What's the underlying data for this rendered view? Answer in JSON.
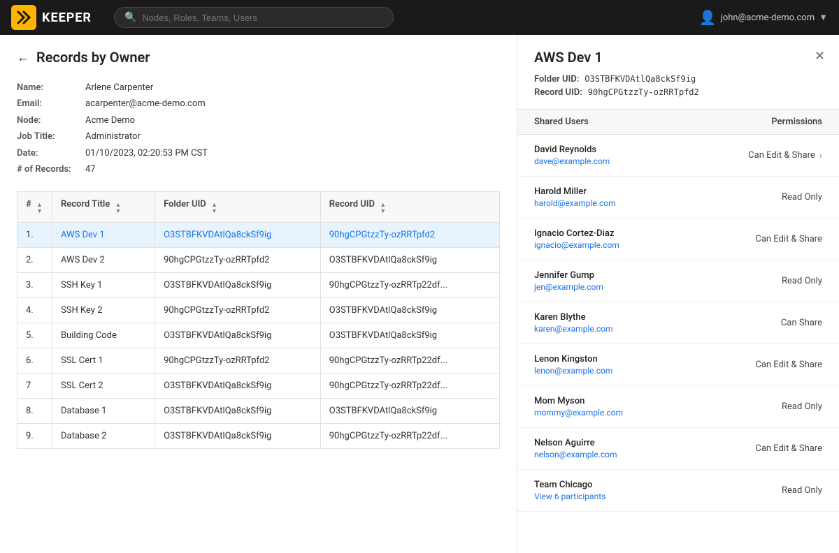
{
  "header": {
    "search_placeholder": "Nodes, Roles, Teams, Users",
    "user_email": "john@acme-demo.com"
  },
  "page": {
    "title": "Records by Owner",
    "back_label": "←"
  },
  "owner": {
    "name_label": "Name:",
    "name_value": "Arlene Carpenter",
    "email_label": "Email:",
    "email_value": "acarpenter@acme-demo.com",
    "node_label": "Node:",
    "node_value": "Acme Demo",
    "job_title_label": "Job Title:",
    "job_title_value": "Administrator",
    "date_label": "Date:",
    "date_value": "01/10/2023, 02:20:53 PM CST",
    "records_label": "# of Records:",
    "records_value": "47"
  },
  "table": {
    "columns": [
      {
        "id": "num",
        "label": "#",
        "sortable": true
      },
      {
        "id": "title",
        "label": "Record Title",
        "sortable": true
      },
      {
        "id": "folder_uid",
        "label": "Folder UID",
        "sortable": true
      },
      {
        "id": "record_uid",
        "label": "Record UID",
        "sortable": true
      }
    ],
    "rows": [
      {
        "num": "1.",
        "title": "AWS Dev 1",
        "folder_uid": "O3STBFKVDAtlQa8ckSf9ig",
        "record_uid": "90hgCPGtzzTy-ozRRTpfd2",
        "selected": true,
        "link": true
      },
      {
        "num": "2.",
        "title": "AWS Dev 2",
        "folder_uid": "90hgCPGtzzTy-ozRRTpfd2",
        "record_uid": "O3STBFKVDAtlQa8ckSf9ig",
        "selected": false,
        "link": false
      },
      {
        "num": "3.",
        "title": "SSH Key 1",
        "folder_uid": "O3STBFKVDAtlQa8ckSf9ig",
        "record_uid": "90hgCPGtzzTy-ozRRTp22df...",
        "selected": false,
        "link": false
      },
      {
        "num": "4.",
        "title": "SSH Key 2",
        "folder_uid": "90hgCPGtzzTy-ozRRTpfd2",
        "record_uid": "O3STBFKVDAtlQa8ckSf9ig",
        "selected": false,
        "link": false
      },
      {
        "num": "5.",
        "title": "Building Code",
        "folder_uid": "O3STBFKVDAtlQa8ckSf9ig",
        "record_uid": "O3STBFKVDAtlQa8ckSf9ig",
        "selected": false,
        "link": false
      },
      {
        "num": "6.",
        "title": "SSL Cert 1",
        "folder_uid": "90hgCPGtzzTy-ozRRTpfd2",
        "record_uid": "90hgCPGtzzTy-ozRRTp22df...",
        "selected": false,
        "link": false
      },
      {
        "num": "7",
        "title": "SSL Cert 2",
        "folder_uid": "O3STBFKVDAtlQa8ckSf9ig",
        "record_uid": "90hgCPGtzzTy-ozRRTp22df...",
        "selected": false,
        "link": false
      },
      {
        "num": "8.",
        "title": "Database 1",
        "folder_uid": "O3STBFKVDAtlQa8ckSf9ig",
        "record_uid": "O3STBFKVDAtlQa8ckSf9ig",
        "selected": false,
        "link": false
      },
      {
        "num": "9.",
        "title": "Database 2",
        "folder_uid": "O3STBFKVDAtlQa8ckSf9ig",
        "record_uid": "90hgCPGtzzTy-ozRRTp22df...",
        "selected": false,
        "link": false
      }
    ]
  },
  "detail_panel": {
    "title": "AWS Dev 1",
    "folder_uid_label": "Folder UID:",
    "folder_uid_value": "O3STBFKVDAtlQa8ckSf9ig",
    "record_uid_label": "Record UID:",
    "record_uid_value": "90hgCPGtzzTy-ozRRTpfd2",
    "shared_users_label": "Shared Users",
    "permissions_label": "Permissions",
    "users": [
      {
        "name": "David Reynolds",
        "email": "dave@example.com",
        "permission": "Can Edit & Share",
        "has_arrow": true
      },
      {
        "name": "Harold Miller",
        "email": "harold@example.com",
        "permission": "Read Only",
        "has_arrow": false
      },
      {
        "name": "Ignacio Cortez-Diaz",
        "email": "ignacio@example.com",
        "permission": "Can Edit & Share",
        "has_arrow": false
      },
      {
        "name": "Jennifer Gump",
        "email": "jen@example.com",
        "permission": "Read Only",
        "has_arrow": false
      },
      {
        "name": "Karen Blythe",
        "email": "karen@example.com",
        "permission": "Can Share",
        "has_arrow": false
      },
      {
        "name": "Lenon Kingston",
        "email": "lenon@example.com",
        "permission": "Can Edit & Share",
        "has_arrow": false
      },
      {
        "name": "Mom Myson",
        "email": "mommy@example.com",
        "permission": "Read Only",
        "has_arrow": false
      },
      {
        "name": "Nelson Aguirre",
        "email": "nelson@example.com",
        "permission": "Can Edit & Share",
        "has_arrow": false
      },
      {
        "name": "Team Chicago",
        "email": "View 6 participants",
        "permission": "Read Only",
        "has_arrow": false
      }
    ]
  }
}
